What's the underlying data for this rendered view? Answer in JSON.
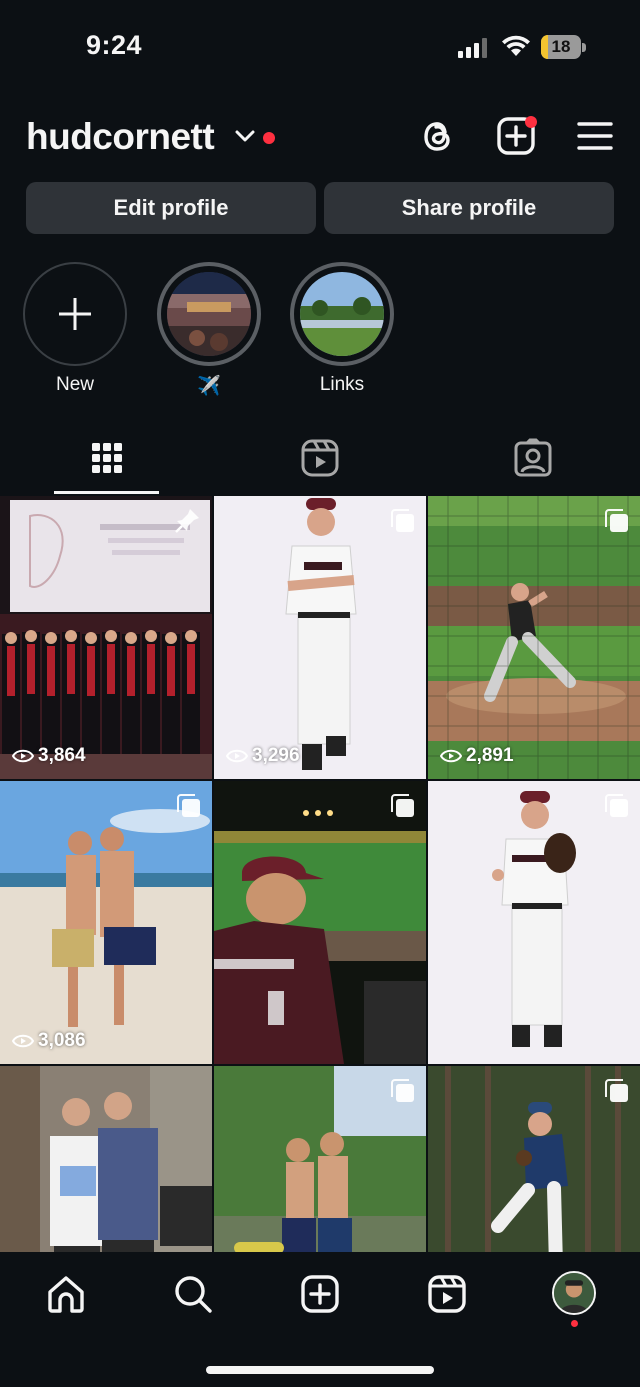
{
  "status_bar": {
    "time": "9:24",
    "battery": "18",
    "battery_level": 0.18
  },
  "header": {
    "username": "hudcornett"
  },
  "buttons": {
    "edit_profile": "Edit profile",
    "share_profile": "Share profile"
  },
  "highlights": [
    {
      "label": "New",
      "icon": "plus-icon"
    },
    {
      "label": "✈️",
      "icon": "arena-photo"
    },
    {
      "label": "Links",
      "icon": "lake-photo"
    }
  ],
  "tabs": [
    "grid-icon",
    "reels-icon",
    "tagged-icon"
  ],
  "posts": [
    {
      "views": "3,864",
      "badge": "pin-icon"
    },
    {
      "views": "3,296",
      "badge": "carousel-icon"
    },
    {
      "views": "2,891",
      "badge": "carousel-icon"
    },
    {
      "views": "3,086",
      "badge": "carousel-icon"
    },
    {
      "views": "",
      "badge": "carousel-icon"
    },
    {
      "views": "",
      "badge": "carousel-icon"
    },
    {
      "views": "",
      "badge": ""
    },
    {
      "views": "",
      "badge": "carousel-icon"
    },
    {
      "views": "",
      "badge": "carousel-icon"
    }
  ],
  "bottom_nav": [
    "home-icon",
    "search-icon",
    "create-icon",
    "reels-icon",
    "profile-avatar"
  ],
  "colors": {
    "background": "#0c1014",
    "button": "#2f3338",
    "notification": "#ff3040",
    "text": "#f5f5f5"
  }
}
